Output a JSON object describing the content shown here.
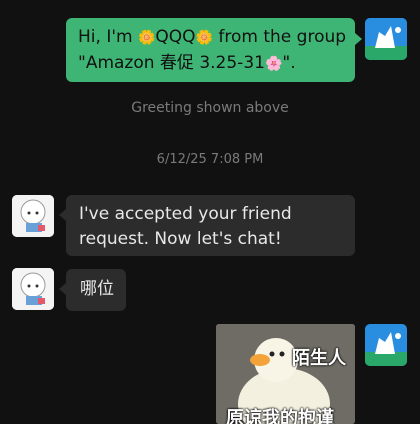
{
  "messages": {
    "greeting": {
      "line1_prefix": "Hi, I'm ",
      "emoji1": "🌼",
      "name": "QQQ",
      "emoji2": "🌼",
      "line1_suffix": " from the group",
      "line2": "\"Amazon 春促 3.25-31",
      "emoji3": "🌸",
      "line2_suffix": "\"."
    },
    "greeting_note": "Greeting shown above",
    "timestamp": "6/12/25 7:08 PM",
    "reply1": "I've accepted your friend request. Now let's chat!",
    "reply2": "哪位",
    "sticker": {
      "text_top": "陌生人",
      "text_bottom": "原谅我的抱谨"
    }
  },
  "colors": {
    "background": "#111111",
    "self_bubble": "#3eb575",
    "other_bubble": "#2c2c2c",
    "system_text": "#7a7a7a"
  }
}
